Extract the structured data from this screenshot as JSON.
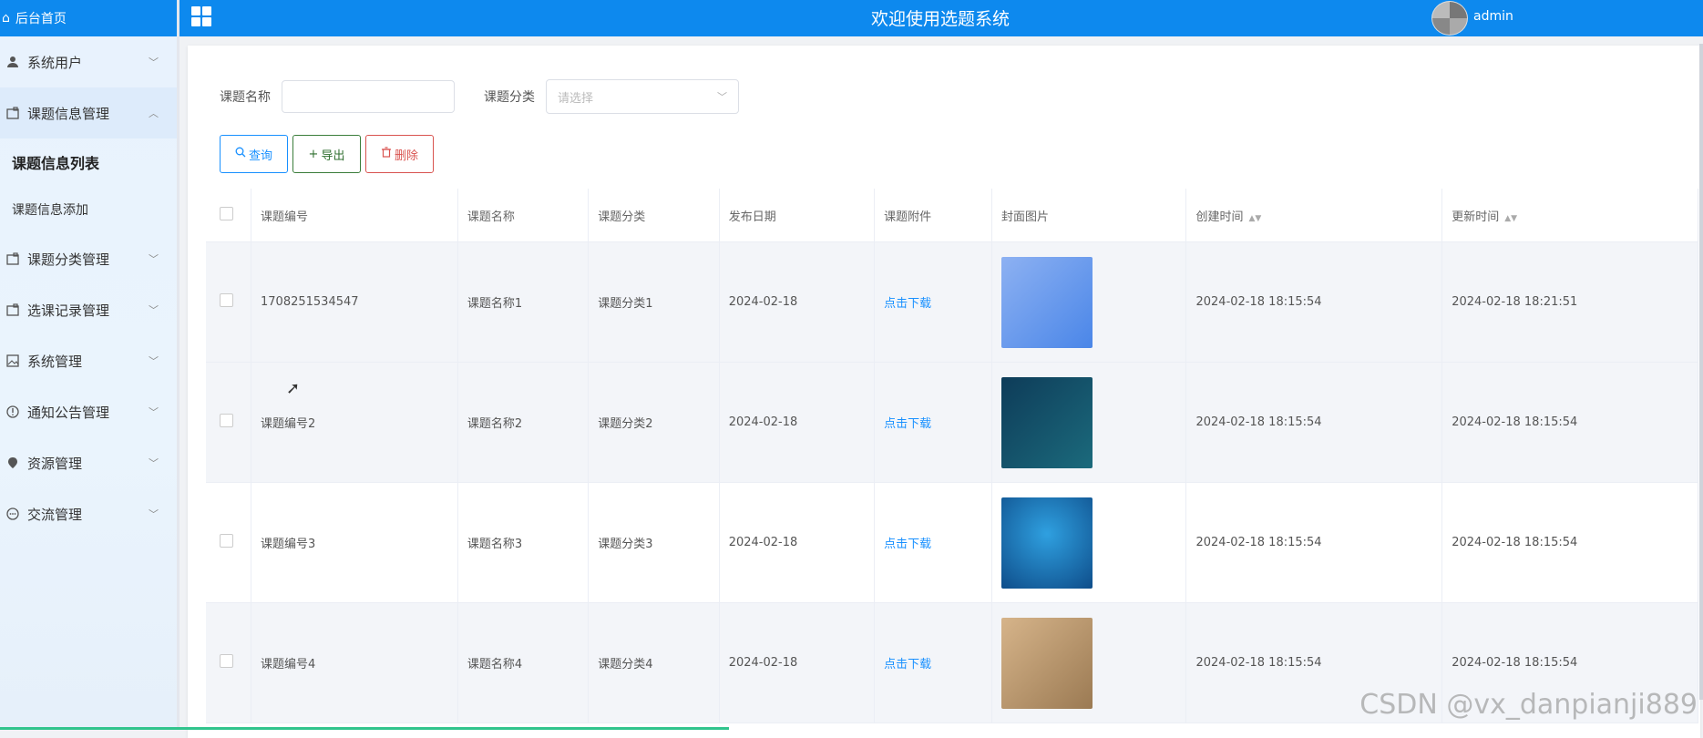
{
  "sidebar": {
    "home_label": "后台首页",
    "items": [
      {
        "label": "系统用户",
        "icon": "user-icon",
        "open": false
      },
      {
        "label": "课题信息管理",
        "icon": "folder-icon",
        "open": true,
        "children": [
          {
            "label": "课题信息列表",
            "active": true
          },
          {
            "label": "课题信息添加",
            "active": false
          }
        ]
      },
      {
        "label": "课题分类管理",
        "icon": "folder-icon",
        "open": false
      },
      {
        "label": "选课记录管理",
        "icon": "folder-icon",
        "open": false
      },
      {
        "label": "系统管理",
        "icon": "image-icon",
        "open": false
      },
      {
        "label": "通知公告管理",
        "icon": "info-icon",
        "open": false
      },
      {
        "label": "资源管理",
        "icon": "pin-icon",
        "open": false
      },
      {
        "label": "交流管理",
        "icon": "chat-icon",
        "open": false
      }
    ]
  },
  "header": {
    "title": "欢迎使用选题系统",
    "username": "admin"
  },
  "search": {
    "name_label": "课题名称",
    "name_value": "",
    "category_label": "课题分类",
    "category_placeholder": "请选择"
  },
  "buttons": {
    "query": "查询",
    "export": "导出",
    "delete": "删除"
  },
  "table": {
    "columns": [
      "课题编号",
      "课题名称",
      "课题分类",
      "发布日期",
      "课题附件",
      "封面图片",
      "创建时间",
      "更新时间"
    ],
    "rows": [
      {
        "code": "1708251534547",
        "name": "课题名称1",
        "category": "课题分类1",
        "date": "2024-02-18",
        "attachment": "点击下载",
        "created": "2024-02-18 18:15:54",
        "updated": "2024-02-18 18:21:51"
      },
      {
        "code": "课题编号2",
        "name": "课题名称2",
        "category": "课题分类2",
        "date": "2024-02-18",
        "attachment": "点击下载",
        "created": "2024-02-18 18:15:54",
        "updated": "2024-02-18 18:15:54"
      },
      {
        "code": "课题编号3",
        "name": "课题名称3",
        "category": "课题分类3",
        "date": "2024-02-18",
        "attachment": "点击下载",
        "created": "2024-02-18 18:15:54",
        "updated": "2024-02-18 18:15:54"
      },
      {
        "code": "课题编号4",
        "name": "课题名称4",
        "category": "课题分类4",
        "date": "2024-02-18",
        "attachment": "点击下载",
        "created": "2024-02-18 18:15:54",
        "updated": "2024-02-18 18:15:54"
      }
    ]
  },
  "watermark": "CSDN @vx_danpianji889",
  "colors": {
    "primary": "#0d89ee",
    "link": "#1890ff",
    "danger": "#d9534f",
    "export": "#2f6e2f"
  }
}
